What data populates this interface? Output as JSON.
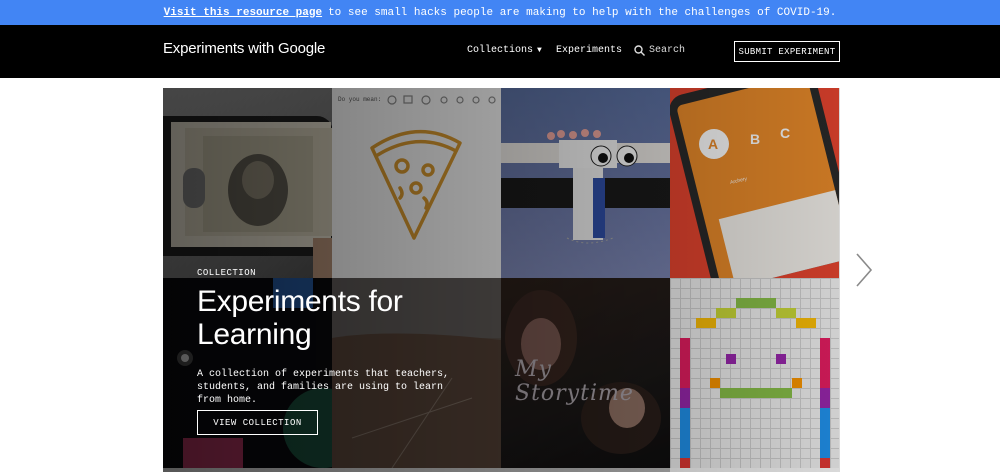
{
  "banner": {
    "link_text": "Visit this resource page",
    "message": "to see small hacks people are making to help with the challenges of COVID-19."
  },
  "header": {
    "brand": "Experiments with Google",
    "nav": {
      "collections": "Collections",
      "experiments": "Experiments",
      "search": "Search"
    },
    "submit": "SUBMIT EXPERIMENT"
  },
  "hero": {
    "eyebrow": "COLLECTION",
    "title": "Experiments for Learning",
    "description": "A collection of experiments that teachers, students, and families are using to learn from home.",
    "cta": "VIEW COLLECTION",
    "tiles": {
      "draw_prompt": "Do you mean:",
      "letters": [
        "A",
        "B",
        "C"
      ],
      "letter_caption": "Archery",
      "storytime": "My Storytime"
    }
  },
  "colors": {
    "banner": "#4285f4",
    "header": "#000000",
    "accent_orange": "#e8902a",
    "pizza_stroke": "#d4962e"
  }
}
